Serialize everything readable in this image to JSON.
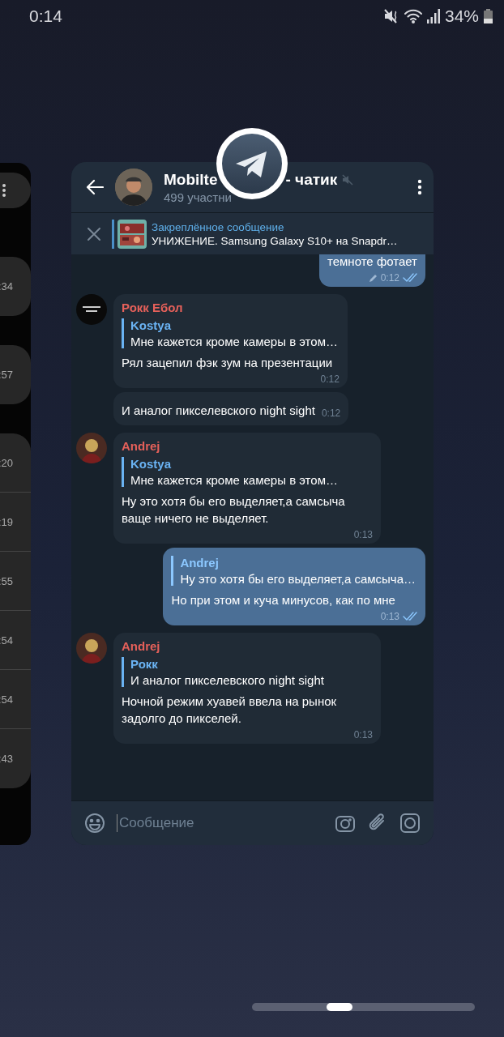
{
  "status_bar": {
    "time": "0:14",
    "battery": "34%"
  },
  "side_card": {
    "times": [
      ":34",
      ":57",
      ":20",
      ":19",
      ":55",
      ":54",
      ":54",
      ":43"
    ]
  },
  "chat": {
    "title_start": "Mobilte",
    "title_end": "- чатик",
    "muted": true,
    "subtitle": "499 участни",
    "pinned": {
      "label": "Закреплённое сообщение",
      "text": "УНИЖЕНИЕ. Samsung Galaxy S10+ на Snapdr…"
    },
    "messages": [
      {
        "out": true,
        "text": "темноте фотает",
        "time": "0:12",
        "edited": true,
        "read": true
      },
      {
        "out": false,
        "sender": "Рокк Ебол",
        "avatar": true,
        "reply": {
          "name": "Kostya",
          "text": "Мне кажется кроме камеры в этом…"
        },
        "text": "Рял зацепил фэк зум на презентации",
        "time": "0:12"
      },
      {
        "out": false,
        "avatar": false,
        "text": "И аналог пикселевского night sight",
        "time": "0:12"
      },
      {
        "out": false,
        "sender": "Andrej",
        "avatar": true,
        "reply": {
          "name": "Kostya",
          "text": "Мне кажется кроме камеры в этом…"
        },
        "text": "Ну это хотя бы его выделяет,а самсыча ваще ничего не выделяет.",
        "time": "0:13"
      },
      {
        "out": true,
        "reply": {
          "name": "Andrej",
          "text": "Ну это хотя бы его выделяет,а самсыча…"
        },
        "text": "Но при этом и куча минусов, как по мне",
        "time": "0:13",
        "read": true
      },
      {
        "out": false,
        "sender": "Andrej",
        "avatar": true,
        "reply": {
          "name": "Рокк",
          "text": "И аналог пикселевского night sight"
        },
        "text": "Ночной режим хуавей ввела на рынок задолго до пикселей.",
        "time": "0:13"
      }
    ],
    "input": {
      "placeholder": "Сообщение"
    }
  }
}
